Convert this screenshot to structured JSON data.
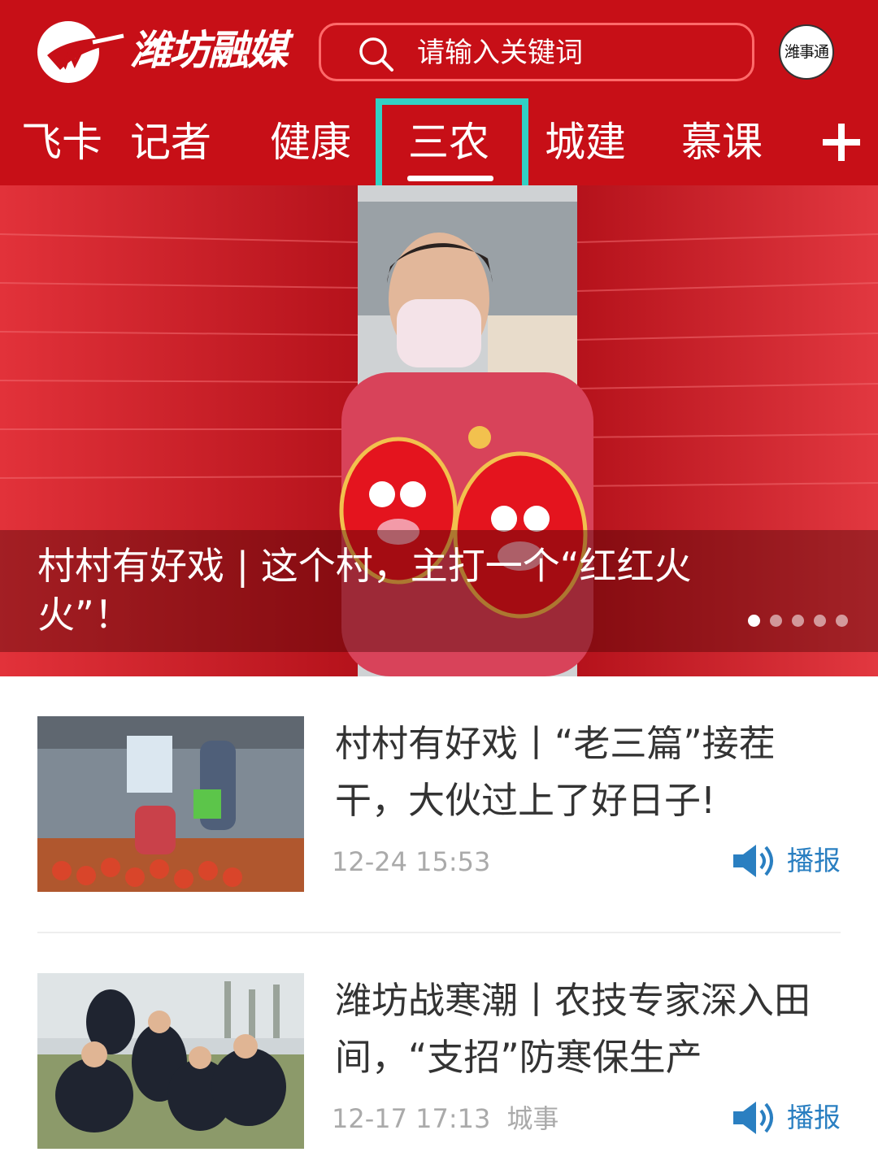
{
  "app": {
    "brand_name": "潍坊融媒"
  },
  "search": {
    "placeholder": "请输入关键词"
  },
  "mini_app_label": "潍事通",
  "tabs": [
    {
      "label": "飞卡"
    },
    {
      "label": "记者"
    },
    {
      "label": "健康"
    },
    {
      "label": "三农",
      "active": true
    },
    {
      "label": "城建"
    },
    {
      "label": "慕课"
    }
  ],
  "banner": {
    "title": "村村有好戏 | 这个村，主打一个“红红火火”！",
    "slide_count": 5,
    "active_slide": 1
  },
  "news": [
    {
      "title": "村村有好戏丨“老三篇”接茬干，大伙过上了好日子!",
      "time": "12-24 15:53",
      "source": "",
      "speak_label": "播报"
    },
    {
      "title": "潍坊战寒潮丨农技专家深入田间，“支招”防寒保生产",
      "time": "12-17 17:13",
      "source": "城事",
      "speak_label": "播报"
    }
  ],
  "colors": {
    "brand_red": "#c70f17",
    "tab_highlight": "#32d1c4",
    "speak_blue": "#2a7fc1"
  },
  "icons": [
    "logo-icon",
    "search-icon",
    "add-tab-icon",
    "speaker-icon"
  ]
}
